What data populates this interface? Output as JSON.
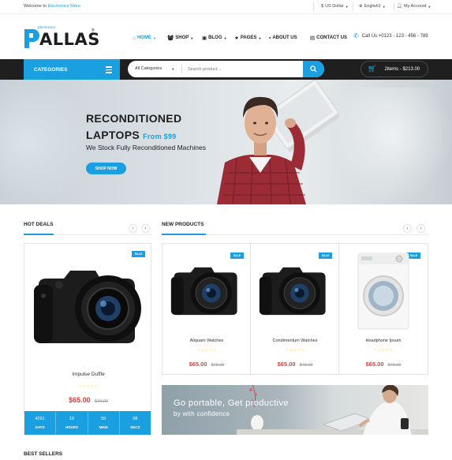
{
  "topbar": {
    "welcome_prefix": "Welcome to",
    "welcome_store": "Electronics Store",
    "currency": "US Dollar",
    "language": "English1",
    "account": "My Account"
  },
  "header": {
    "logo_text": "ALLAS",
    "logo_sub": "Electronics",
    "logo_reg": "®",
    "nav": [
      {
        "label": "HOME",
        "icon": "home-icon",
        "dropdown": true,
        "active": true
      },
      {
        "label": "SHOP",
        "icon": "basket-icon",
        "dropdown": true
      },
      {
        "label": "BLOG",
        "icon": "book-icon",
        "dropdown": true
      },
      {
        "label": "PAGES",
        "icon": "star-icon",
        "dropdown": true
      },
      {
        "label": "ABOUT US",
        "icon": "chat-icon",
        "dropdown": false
      },
      {
        "label": "CONTACT US",
        "icon": "contact-card-icon",
        "dropdown": false
      }
    ],
    "call": "Call Us:+0123 - 123 - 456 - 789"
  },
  "searchbar": {
    "categories_label": "CATEGORIES",
    "category_select": "All Categories",
    "placeholder": "Search product...",
    "cart_summary": "2items - $213.00"
  },
  "hero": {
    "title_line1": "RECONDITIONED",
    "title_line2": "LAPTOPS",
    "from_price": "From $99",
    "description": "We Stock Fully Reconditioned Machines",
    "cta": "SHOP NOW"
  },
  "hot_deals": {
    "title": "HOT DEALS",
    "product": {
      "badge": "SALE",
      "name": "Impulse Duffle",
      "price": "$65.00",
      "old_price": "$70.00",
      "rating": 0
    },
    "countdown": [
      {
        "value": "4291",
        "label": "DAYS"
      },
      {
        "value": "10",
        "label": "HOURS"
      },
      {
        "value": "59",
        "label": "MINS"
      },
      {
        "value": "08",
        "label": "SECS"
      }
    ]
  },
  "new_products": {
    "title": "NEW PRODUCTS",
    "items": [
      {
        "badge": "SALE",
        "name": "Aliquam Watches",
        "price": "$65.00",
        "old_price": "$70.00",
        "image": "camera"
      },
      {
        "badge": "SALE",
        "name": "Condimentum Watches",
        "price": "$65.00",
        "old_price": "$70.00",
        "image": "camera"
      },
      {
        "badge": "SALE",
        "name": "Headphone Ipsum",
        "price": "$65.00",
        "old_price": "$70.00",
        "image": "washing-machine"
      }
    ]
  },
  "banner": {
    "line1": "Go portable, Get productive",
    "line2": "by with confidence"
  },
  "best_sellers": {
    "title": "BEST SELLERS"
  },
  "colors": {
    "accent": "#1a9fe0",
    "dark_bar": "#1f1f1f",
    "price_red": "#e33b3b",
    "star_gold": "#f3c32d"
  },
  "stars_glyph": "☆☆☆☆☆"
}
